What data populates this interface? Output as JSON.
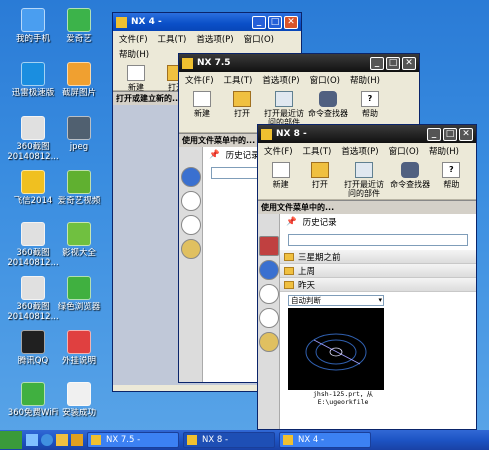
{
  "desktop": {
    "icons": [
      {
        "label": "我的手机",
        "color": "#4a9ef0"
      },
      {
        "label": "爱奇艺",
        "color": "#3cb34a"
      },
      {
        "label": "迅雷极速版",
        "color": "#1a8ee0"
      },
      {
        "label": "截屏图片",
        "color": "#f0a030"
      },
      {
        "label": "360截图\n20140812...",
        "color": "#e0e0e0"
      },
      {
        "label": "jpeg",
        "color": "#506070"
      },
      {
        "label": "飞信2014",
        "color": "#f0c020"
      },
      {
        "label": "爱奇艺视频",
        "color": "#60b030"
      },
      {
        "label": "360截图\n20140812...",
        "color": "#e0e0e0"
      },
      {
        "label": "影视大全",
        "color": "#70c040"
      },
      {
        "label": "360截图\n20140812...",
        "color": "#e0e0e0"
      },
      {
        "label": "绿色浏览器",
        "color": "#40b040"
      },
      {
        "label": "腾讯QQ",
        "color": "#202020"
      },
      {
        "label": "外挂说明",
        "color": "#e04040"
      },
      {
        "label": "360免费WiFi",
        "color": "#40b040"
      },
      {
        "label": "安装成功",
        "color": "#f0f0f0"
      }
    ]
  },
  "window_nx4": {
    "title": "NX 4 -",
    "menu": [
      "文件(F)",
      "工具(T)",
      "首选项(P)",
      "窗口(O)"
    ],
    "menu2": [
      "帮助(H)"
    ],
    "toolbar": [
      "新建",
      "打开"
    ],
    "status": "打开或建立新的..."
  },
  "window_nx75": {
    "title": "NX 7.5",
    "menu": [
      "文件(F)",
      "工具(T)",
      "首选项(P)",
      "窗口(O)",
      "帮助(H)"
    ],
    "toolbar": [
      "新建",
      "打开",
      "打开最近访问的部件",
      "命令查找器",
      "帮助"
    ],
    "status": "使用文件菜单中的...",
    "history_label": "历史记录"
  },
  "window_nx8": {
    "title": "NX 8 -",
    "menu": [
      "文件(F)",
      "工具(T)",
      "首选项(P)",
      "窗口(O)",
      "帮助(H)"
    ],
    "toolbar": [
      "新建",
      "打开",
      "打开最近访问的部件",
      "命令查找器",
      "帮助"
    ],
    "status": "使用文件菜单中的...",
    "history_label": "历史记录",
    "groups": [
      "三星期之前",
      "上周",
      "昨天"
    ],
    "dropdown_value": "自动判断",
    "file_caption_line1": "jhsh-125.prt，从",
    "file_caption_line2": "E:\\ugeorkfile"
  },
  "taskbar": {
    "tasks": [
      "NX 7.5 -",
      "NX 8 -",
      "NX 4 -"
    ]
  }
}
